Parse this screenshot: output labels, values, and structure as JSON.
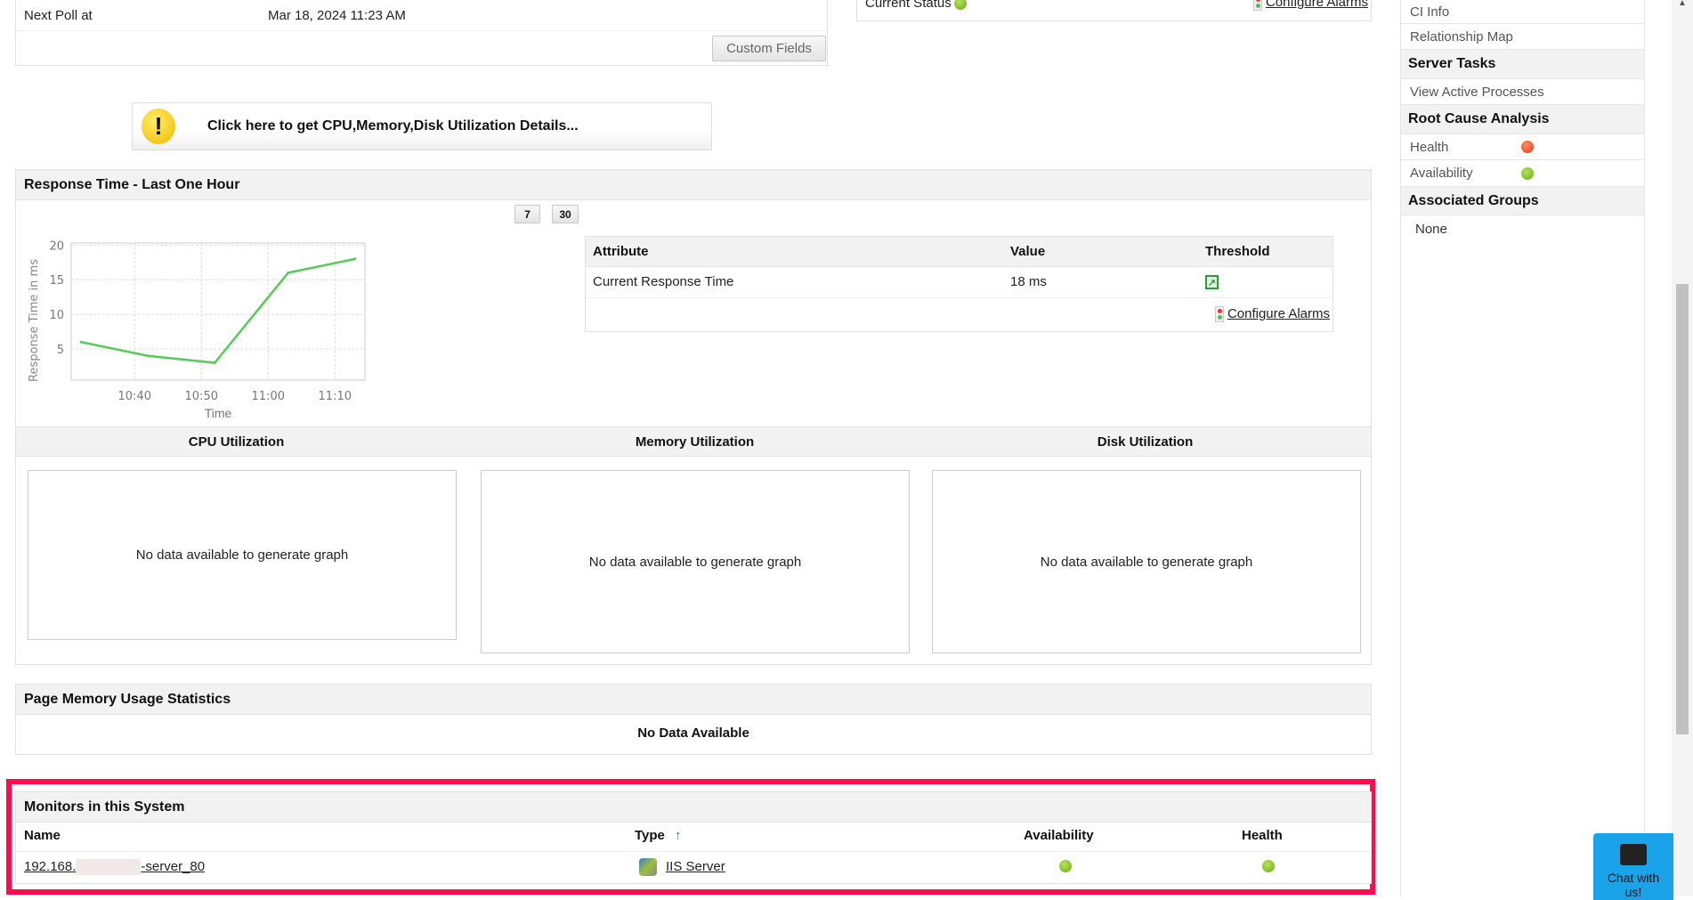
{
  "top_panel": {
    "next_poll_label": "Next Poll at",
    "next_poll_value": "Mar 18, 2024 11:23 AM",
    "custom_fields_button": "Custom Fields"
  },
  "status_panel": {
    "current_status_label": "Current Status",
    "configure_alarms": "Configure Alarms"
  },
  "alert_banner": {
    "text": "Click here to get CPU,Memory,Disk Utilization Details..."
  },
  "response_time": {
    "title": "Response Time - Last One Hour",
    "period_buttons": [
      "7",
      "30"
    ],
    "table": {
      "headers": [
        "Attribute",
        "Value",
        "Threshold"
      ],
      "rows": [
        {
          "attribute": "Current Response Time",
          "value": "18 ms"
        }
      ],
      "configure_alarms": "Configure Alarms"
    }
  },
  "chart_data": {
    "type": "line",
    "title": "",
    "xlabel": "Time",
    "ylabel": "Response Time in ms",
    "x": [
      "10:32",
      "10:42",
      "10:52",
      "11:03",
      "11:13"
    ],
    "x_minutes": [
      -8,
      2,
      12,
      23,
      33
    ],
    "values": [
      6,
      4,
      3,
      16,
      18
    ],
    "xticks": [
      "10:40",
      "10:50",
      "11:00",
      "11:10"
    ],
    "yticks": [
      5,
      10,
      15,
      20
    ],
    "ylim": [
      0.5,
      20.3
    ],
    "xlim_minutes": [
      -9.5,
      34.5
    ],
    "grid": true,
    "color": "#55cc55"
  },
  "utilization": {
    "headers": [
      "CPU Utilization",
      "Memory Utilization",
      "Disk Utilization"
    ],
    "no_data": "No data available to generate graph"
  },
  "page_memory": {
    "title": "Page Memory Usage Statistics",
    "no_data": "No Data Available"
  },
  "monitors": {
    "title": "Monitors in this System",
    "headers": {
      "name": "Name",
      "type": "Type",
      "sort_arrow": "↑",
      "availability": "Availability",
      "health": "Health"
    },
    "rows": [
      {
        "name_prefix": "192.168.",
        "name_suffix": "-server_80",
        "type": "IIS Server",
        "availability": "up",
        "health": "clear"
      }
    ]
  },
  "sidebar": {
    "ci_info": "CI Info",
    "relationship_map": "Relationship Map",
    "server_tasks": "Server Tasks",
    "view_active_processes": "View Active Processes",
    "root_cause": "Root Cause Analysis",
    "health": "Health",
    "availability": "Availability",
    "associated_groups": "Associated Groups",
    "none": "None"
  },
  "chat": {
    "label": "Chat with us!"
  }
}
